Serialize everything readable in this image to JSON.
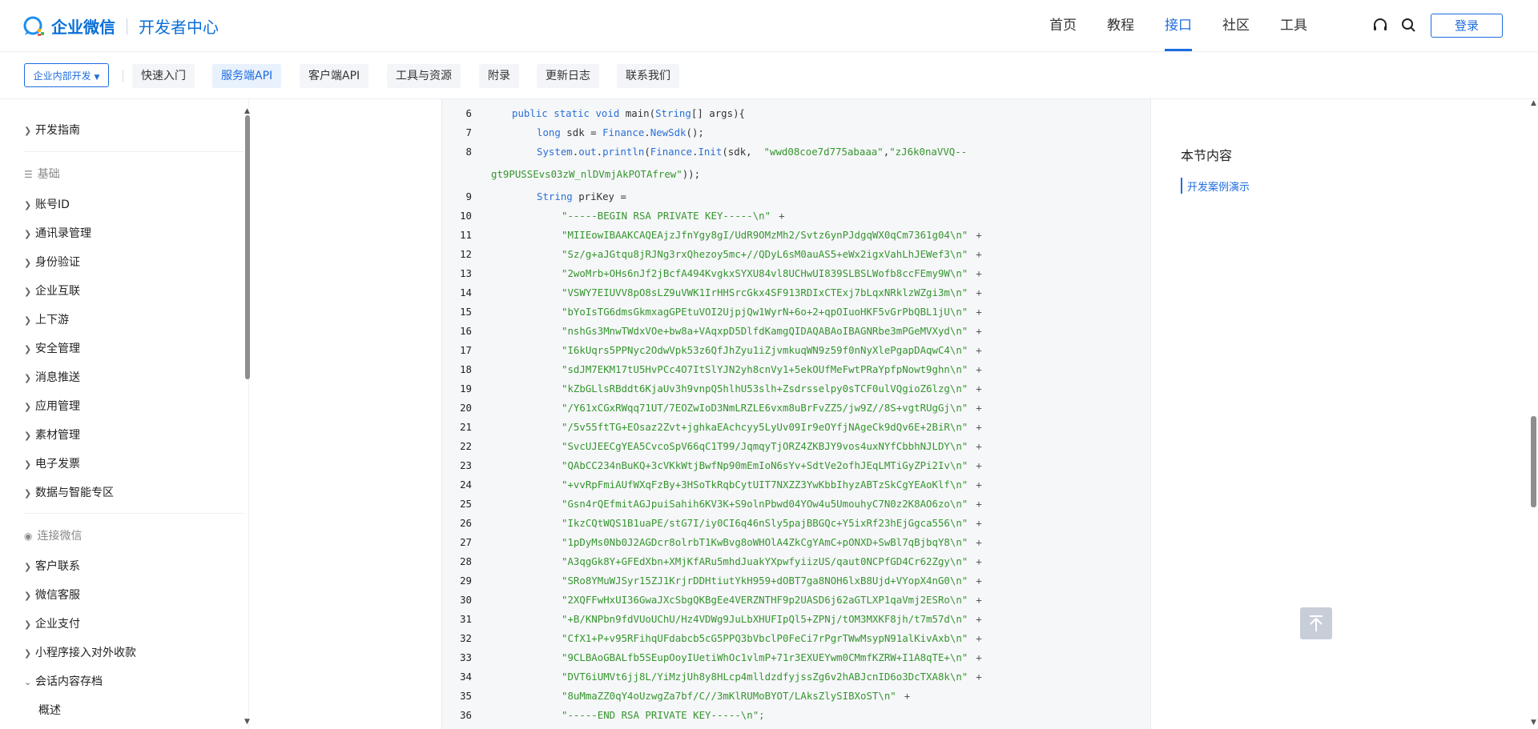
{
  "header": {
    "logo_title": "企业微信",
    "logo_sub": "开发者中心",
    "nav": [
      "首页",
      "教程",
      "接口",
      "社区",
      "工具"
    ],
    "active_nav": "接口",
    "login_label": "登录",
    "icons": [
      "headset-icon",
      "search-icon"
    ]
  },
  "subnav": {
    "scope_label": "企业内部开发",
    "items": [
      "快速入门",
      "服务端API",
      "客户端API",
      "工具与资源",
      "附录",
      "更新日志",
      "联系我们"
    ],
    "active": "服务端API"
  },
  "sidebar": {
    "top_item": "开发指南",
    "group1": "基础",
    "group1_items": [
      "账号ID",
      "通讯录管理",
      "身份验证",
      "企业互联",
      "上下游",
      "安全管理",
      "消息推送",
      "应用管理",
      "素材管理",
      "电子发票",
      "数据与智能专区"
    ],
    "group2": "连接微信",
    "group2_items": [
      "客户联系",
      "微信客服",
      "企业支付",
      "小程序接入对外收款"
    ],
    "expanded_item": "会话内容存档",
    "child_item": "概述"
  },
  "code": {
    "line6": [
      "6",
      "public",
      "static",
      "void",
      "main(",
      "String",
      "[] args){"
    ],
    "line7": [
      "7",
      "long",
      " sdk = ",
      "Finance",
      ".",
      "NewSdk",
      "();"
    ],
    "line8": [
      "8",
      "System",
      ".",
      "out",
      ".",
      "println",
      "(",
      "Finance",
      ".",
      "Init",
      "(sdk,  ",
      "\"wwd08coe7d775abaaa\"",
      ",",
      "\"zJ6k0naVVQ--"
    ],
    "line8_cont": [
      "gt9PUSSEvs03zW_nlDVmjAkPOTAfrew\"",
      "));"
    ],
    "line9": [
      "9",
      "String",
      " priKey ="
    ],
    "key_lines": [
      [
        "10",
        "\"-----BEGIN RSA PRIVATE KEY-----\\n\""
      ],
      [
        "11",
        "\"MIIEowIBAAKCAQEAjzJfnYgy8gI/UdR9OMzMh2/Svtz6ynPJdgqWX0qCm7361g04\\n\""
      ],
      [
        "12",
        "\"Sz/g+aJGtqu8jRJNg3rxQhezoy5mc+//QDyL6sM0auAS5+eWx2igxVahLhJEWef3\\n\""
      ],
      [
        "13",
        "\"2woMrb+OHs6nJf2jBcfA494KvgkxSYXU84vl8UCHwUI839SLBSLWofb8ccFEmy9W\\n\""
      ],
      [
        "14",
        "\"VSWY7EIUVV8pO8sLZ9uVWK1IrHHSrcGkx4SF913RDIxCTExj7bLqxNRklzWZgi3m\\n\""
      ],
      [
        "15",
        "\"bYoIsTG6dmsGkmxagGPEtuVOI2UjpjQw1WyrN+6o+2+qpOIuoHKF5vGrPbQBL1jU\\n\""
      ],
      [
        "16",
        "\"nshGs3MnwTWdxVOe+bw8a+VAqxpD5DlfdKamgQIDAQABAoIBAGNRbe3mPGeMVXyd\\n\""
      ],
      [
        "17",
        "\"I6kUqrs5PPNyc2OdwVpk53z6QfJhZyu1iZjvmkuqWN9z59f0nNyXlePgapDAqwC4\\n\""
      ],
      [
        "18",
        "\"sdJM7EKM17tU5HvPCc4O7ItSlYJN2yh8cnVy1+5ekOUfMeFwtPRaYpfpNowt9ghn\\n\""
      ],
      [
        "19",
        "\"kZbGLlsRBddt6KjaUv3h9vnpQ5hlhU53slh+Zsdrsselpy0sTCF0ulVQgioZ6lzg\\n\""
      ],
      [
        "20",
        "\"/Y61xCGxRWqq71UT/7EOZwIoD3NmLRZLE6vxm8uBrFvZZ5/jw9Z//8S+vgtRUgGj\\n\""
      ],
      [
        "21",
        "\"/5v55ftTG+EOsaz2Zvt+jghkaEAchcyy5LyUv09Ir9eOYfjNAgeCk9dQv6E+2BiR\\n\""
      ],
      [
        "22",
        "\"SvcUJEECgYEA5CvcoSpV66qC1T99/JqmqyTjORZ4ZKBJY9vos4uxNYfCbbhNJLDY\\n\""
      ],
      [
        "23",
        "\"QAbCC234nBuKQ+3cVKkWtjBwfNp90mEmIoN6sYv+SdtVe2ofhJEqLMTiGyZPi2Iv\\n\""
      ],
      [
        "24",
        "\"+vvRpFmiAUfWXqFzBy+3HSoTkRqbCytUIT7NXZZ3YwKbbIhyzABTzSkCgYEAoKlf\\n\""
      ],
      [
        "25",
        "\"Gsn4rQEfmitAGJpuiSahih6KV3K+S9olnPbwd04YOw4u5UmouhyC7N0z2K8AO6zo\\n\""
      ],
      [
        "26",
        "\"IkzCQtWQS1B1uaPE/stG7I/iy0CI6q46nSly5pajBBGQc+Y5ixRf23hEjGgca556\\n\""
      ],
      [
        "27",
        "\"1pDyMs0Nb0J2AGDcr8olrbT1KwBvg8oWHOlA4ZkCgYAmC+pONXD+SwBl7qBjbqY8\\n\""
      ],
      [
        "28",
        "\"A3qgGk8Y+GFEdXbn+XMjKfARu5mhdJuakYXpwfyiizUS/qaut0NCPfGD4Cr62Zgy\\n\""
      ],
      [
        "29",
        "\"SRo8YMuWJSyr15ZJ1KrjrDDHtiutYkH959+dOBT7ga8NOH6lxB8Ujd+VYopX4nG0\\n\""
      ],
      [
        "30",
        "\"2XQFFwHxUI36GwaJXcSbgQKBgEe4VERZNTHF9p2UASD6j62aGTLXP1qaVmj2ESRo\\n\""
      ],
      [
        "31",
        "\"+B/KNPbn9fdVUoUChU/Hz4VDWg9JuLbXHUFIpQl5+ZPNj/tOM3MXKF8jh/t7m57d\\n\""
      ],
      [
        "32",
        "\"CfX1+P+v95RFihqUFdabcb5cG5PPQ3bVbclP0FeCi7rPgrTWwMsypN91alKivAxb\\n\""
      ],
      [
        "33",
        "\"9CLBAoGBALfb5SEupOoyIUetiWhOc1vlmP+71r3EXUEYwm0CMmfKZRW+I1A8qTE+\\n\""
      ],
      [
        "34",
        "\"DVT6iUMVt6jj8L/YiMzjUh8y8HLcp4mlldzdfyjssZg6v2hABJcnID6o3DcTXA8k\\n\""
      ],
      [
        "35",
        "\"8uMmaZZ0qY4oUzwgZa7bf/C//3mKlRUMoBYOT/LAksZlySIBXoST\\n\""
      ],
      [
        "36",
        "\"-----END RSA PRIVATE KEY-----\\n\";"
      ]
    ],
    "plus": "+"
  },
  "toc": {
    "title": "本节内容",
    "link": "开发案例演示"
  },
  "colors": {
    "accent": "#1d6ce0",
    "string": "#35952f",
    "keyword": "#2a6fd6"
  }
}
